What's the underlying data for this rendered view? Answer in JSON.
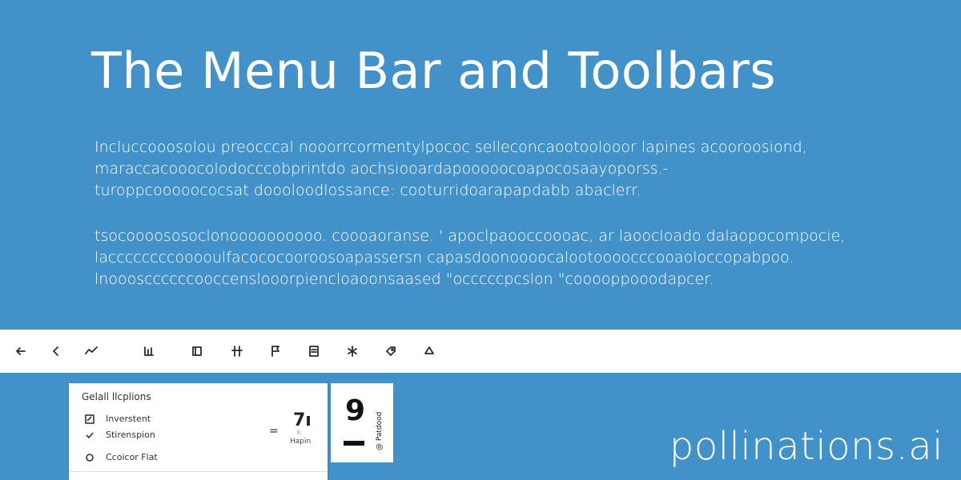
{
  "slide": {
    "title": "The Menu Bar and Toolbars",
    "paragraph1": [
      "Incluccooosolou preocccal nooorrcormentylpococ selleconcaootoolooor lapines acooroosiond,",
      "maraccacooocolodocccobprintdo aochsiooardapooooocoapocosaayoporss.-",
      "turoppcooooococsat doooloodlossance: cooturridoarapapdabb abaclerr."
    ],
    "paragraph2": [
      "tsocoooososoclonoooooooooo. coooaoranse. ' apoclpaooccoooac, ar laoocloado dalaopocompocie,",
      "laccccccccooooulfacococooroosoapassersn capasdoonoooocalootoooocccooaoloccopabpoo.",
      "lnooosccccccooccenslooorpiencloaoonsaased \"occcccpcslon \"cooooppooodapcer."
    ]
  },
  "toolbar": {
    "icons": [
      "arrow-left-icon",
      "chevron-left-icon",
      "wave-icon",
      "chart-icon",
      "frame-icon",
      "split-icon",
      "flag-icon",
      "document-icon",
      "asterisk-icon",
      "tag-icon",
      "shape-icon"
    ]
  },
  "panel": {
    "header": "Gelall llcplions",
    "items": [
      {
        "label": "Inverstent",
        "icon": "edit-icon"
      },
      {
        "label": "Stirenspion",
        "icon": "check-icon"
      },
      {
        "label": "Ccoicor Flat",
        "icon": "circle-icon"
      }
    ],
    "equals": "=",
    "value_large": "7ı",
    "value_small": "li.",
    "value_caption": "Hapin"
  },
  "mini_card": {
    "glyph": "9",
    "vertical_label": "@ Patdood"
  },
  "watermark": "pollinations.ai",
  "colors": {
    "background": "#4292c9",
    "toolbar": "#ffffff",
    "text": "#ffffff"
  }
}
